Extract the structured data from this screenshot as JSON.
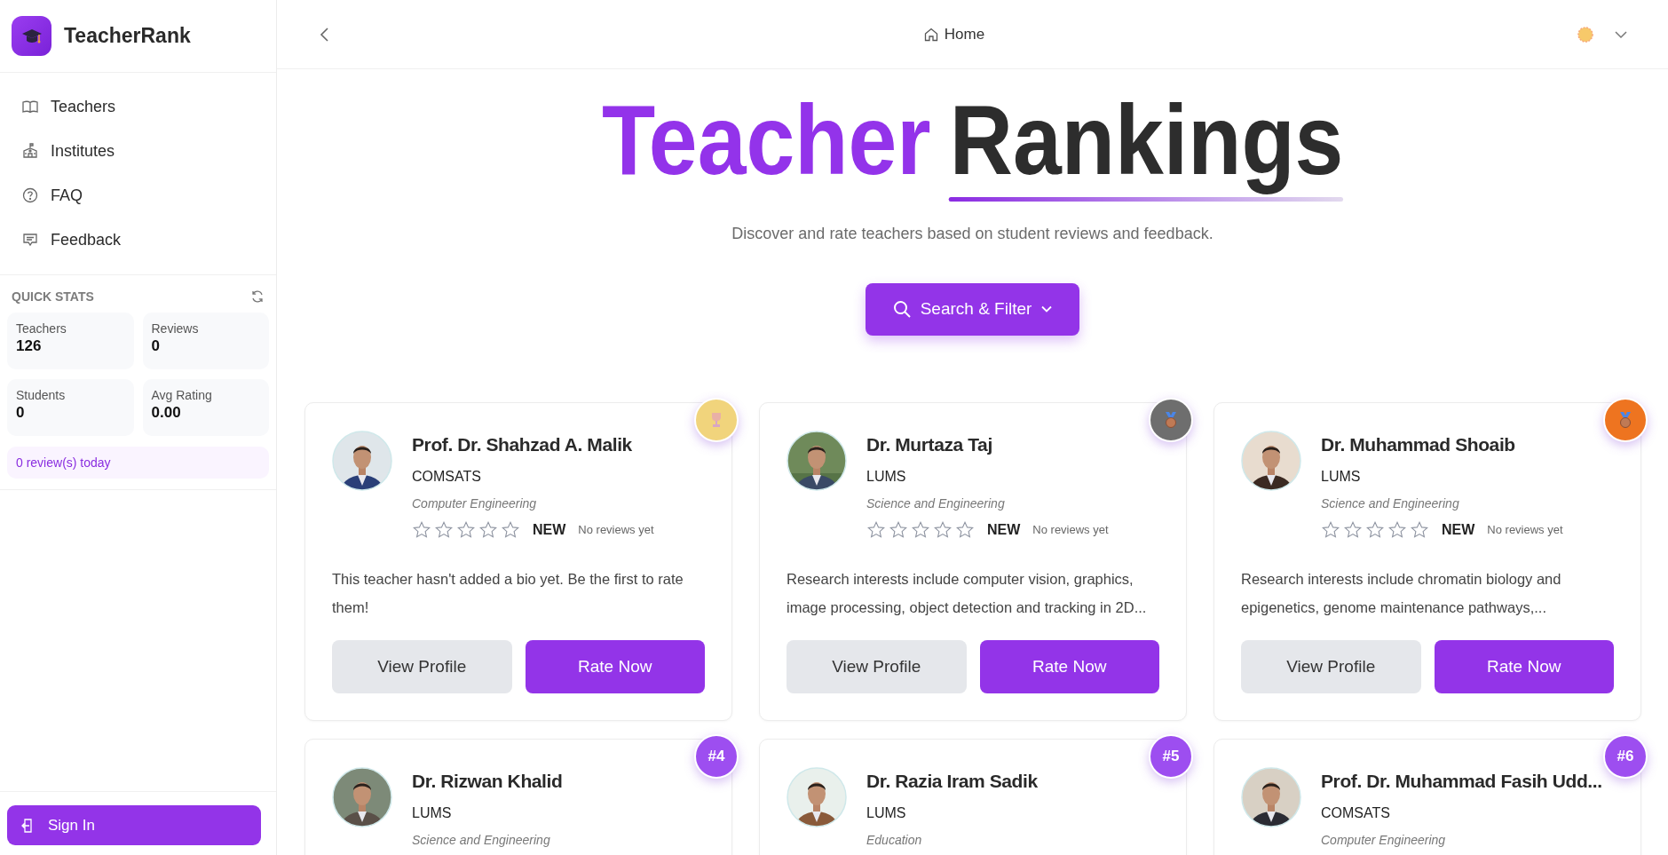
{
  "sidebar": {
    "brand": "TeacherRank",
    "nav": [
      {
        "label": "Teachers",
        "kind": "book"
      },
      {
        "label": "Institutes",
        "kind": "school"
      },
      {
        "label": "FAQ",
        "kind": "help"
      },
      {
        "label": "Feedback",
        "kind": "chat"
      }
    ],
    "quick_stats": {
      "title": "QUICK STATS",
      "stats": [
        {
          "label": "Teachers",
          "value": "126"
        },
        {
          "label": "Reviews",
          "value": "0"
        },
        {
          "label": "Students",
          "value": "0"
        },
        {
          "label": "Avg Rating",
          "value": "0.00"
        }
      ],
      "today": "0 review(s) today"
    },
    "sign_in": "Sign In"
  },
  "header": {
    "breadcrumb": "Home"
  },
  "hero": {
    "title": [
      {
        "text": "Teacher",
        "kind": "accent"
      },
      {
        "text": "Rankings",
        "kind": "plain"
      }
    ],
    "subtitle": "Discover and rate teachers based on student reviews and feedback.",
    "search_button": "Search & Filter"
  },
  "teachers": [
    {
      "name": "Prof. Dr. Shahzad A. Malik",
      "institute": "COMSATS",
      "department": "Computer Engineering",
      "stars": 0,
      "tag": "NEW",
      "reviews": "No reviews yet",
      "bio": "This teacher hasn't added a bio yet. Be the first to rate them!",
      "buttons": [
        "View Profile",
        "Rate Now"
      ],
      "badge": {
        "kind": "trophy",
        "color": "#f1d47c"
      }
    },
    {
      "name": "Dr. Murtaza Taj",
      "institute": "LUMS",
      "department": "Science and Engineering",
      "stars": 0,
      "tag": "NEW",
      "reviews": "No reviews yet",
      "bio": "Research interests include computer vision, graphics, image processing, object detection and tracking in 2D...",
      "buttons": [
        "View Profile",
        "Rate Now"
      ],
      "badge": {
        "kind": "medal",
        "color": "#6e6e6e"
      }
    },
    {
      "name": "Dr. Muhammad Shoaib",
      "institute": "LUMS",
      "department": "Science and Engineering",
      "stars": 0,
      "tag": "NEW",
      "reviews": "No reviews yet",
      "bio": "Research interests include chromatin biology and epigenetics, genome maintenance pathways,...",
      "buttons": [
        "View Profile",
        "Rate Now"
      ],
      "badge": {
        "kind": "medal",
        "color": "#ee7420"
      }
    },
    {
      "name": "Dr. Rizwan Khalid",
      "institute": "LUMS",
      "department": "Science and Engineering",
      "badge": {
        "kind": "number",
        "label": "#4",
        "color": "#9d4ef0"
      }
    },
    {
      "name": "Dr. Razia Iram Sadik",
      "institute": "LUMS",
      "department": "Education",
      "badge": {
        "kind": "number",
        "label": "#5",
        "color": "#9d4ef0"
      }
    },
    {
      "name": "Prof. Dr. Muhammad Fasih Udd...",
      "institute": "COMSATS",
      "department": "Computer Engineering",
      "badge": {
        "kind": "number",
        "label": "#6",
        "color": "#9d4ef0"
      }
    }
  ]
}
